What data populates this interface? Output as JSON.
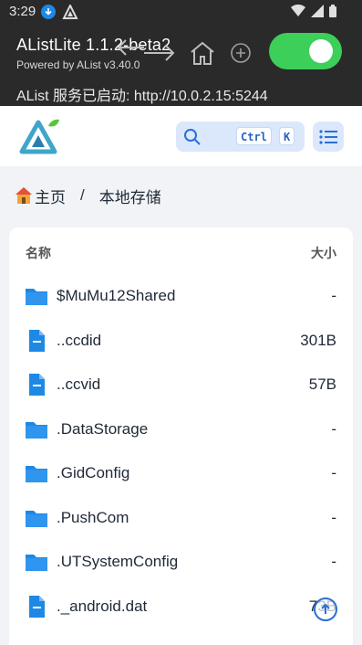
{
  "status_bar": {
    "time": "3:29"
  },
  "app": {
    "title": "AListLite 1.1.2-beta2",
    "subtitle": "Powered by AList v3.40.0",
    "server_status": "AList 服务已启动: http://10.0.2.15:5244",
    "toggle_on": true,
    "accent": "#3ccf5a"
  },
  "search": {
    "ctrl_key": "Ctrl",
    "k_key": "K"
  },
  "breadcrumb": {
    "home": "主页",
    "separator": "/",
    "current": "本地存储"
  },
  "list": {
    "header_name": "名称",
    "header_size": "大小",
    "rows": [
      {
        "icon": "folder-icon",
        "name": "$MuMu12Shared",
        "size": "-"
      },
      {
        "icon": "file-icon",
        "name": "..ccdid",
        "size": "301B"
      },
      {
        "icon": "file-icon",
        "name": "..ccvid",
        "size": "57B"
      },
      {
        "icon": "folder-icon",
        "name": ".DataStorage",
        "size": "-"
      },
      {
        "icon": "folder-icon",
        "name": ".GidConfig",
        "size": "-"
      },
      {
        "icon": "folder-icon",
        "name": ".PushCom",
        "size": "-"
      },
      {
        "icon": "folder-icon",
        "name": ".UTSystemConfig",
        "size": "-"
      },
      {
        "icon": "file-icon",
        "name": "._android.dat",
        "size": "73B"
      }
    ]
  },
  "colors": {
    "primary": "#2b6fd6",
    "folder": "#1e88e5"
  }
}
